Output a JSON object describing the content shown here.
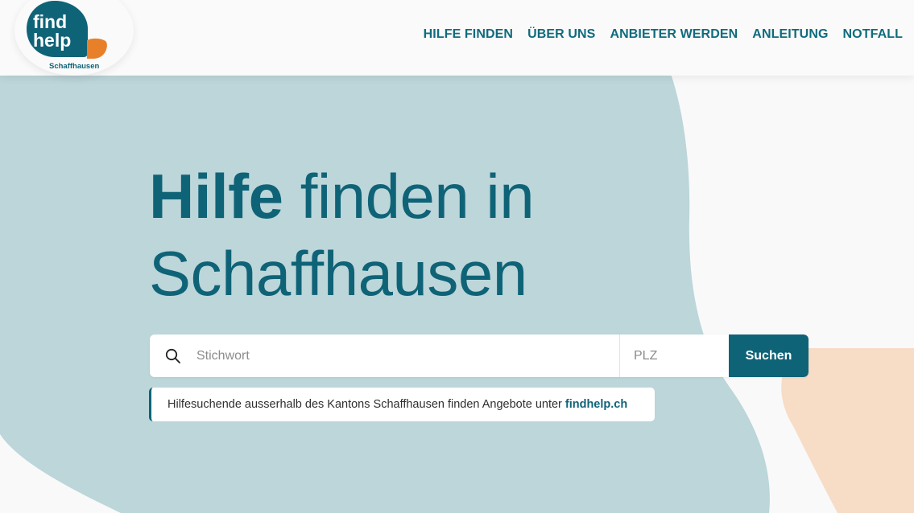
{
  "logo": {
    "line1": "find",
    "line2": "help",
    "region": "Schaffhausen"
  },
  "nav": {
    "items": [
      {
        "label": "HILFE FINDEN"
      },
      {
        "label": "ÜBER UNS"
      },
      {
        "label": "ANBIETER WERDEN"
      },
      {
        "label": "ANLEITUNG"
      },
      {
        "label": "NOTFALL"
      }
    ]
  },
  "hero": {
    "title_bold": "Hilfe",
    "title_rest": "finden in",
    "title_line2": "Schaffhausen"
  },
  "search": {
    "keyword_placeholder": "Stichwort",
    "plz_placeholder": "PLZ",
    "button_label": "Suchen"
  },
  "note": {
    "text": "Hilfesuchende ausserhalb des Kantons Schaffhausen finden Angebote unter",
    "link": "findhelp.ch"
  },
  "colors": {
    "primary": "#0f6377",
    "accent_orange": "#e8802a",
    "blob_blue": "#bcd6da",
    "blob_peach": "#f7dcc6"
  }
}
